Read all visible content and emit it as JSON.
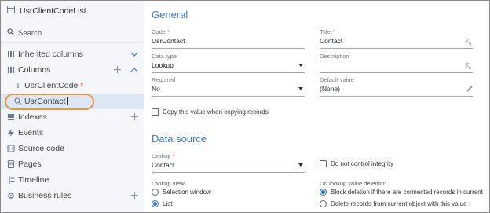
{
  "sidebar": {
    "title": "UsrClientCodeList",
    "search_label": "Search",
    "items": [
      {
        "label": "Inherited columns",
        "icon": "inherited-columns-icon"
      },
      {
        "label": "Columns",
        "icon": "columns-icon"
      },
      {
        "label": "UsrClientCode",
        "required_mark": "*",
        "icon": "text-type-icon"
      },
      {
        "label": "UsrContact",
        "icon": "lookup-search-icon"
      },
      {
        "label": "Indexes",
        "icon": "indexes-icon"
      },
      {
        "label": "Events",
        "icon": "events-icon"
      },
      {
        "label": "Source code",
        "icon": "source-code-icon"
      },
      {
        "label": "Pages",
        "icon": "pages-icon"
      },
      {
        "label": "Timeline",
        "icon": "timeline-icon"
      },
      {
        "label": "Business rules",
        "icon": "business-rules-icon"
      }
    ]
  },
  "general": {
    "heading": "General",
    "code": {
      "label": "Code",
      "required": "*",
      "value": "UsrContact"
    },
    "title": {
      "label": "Title",
      "required": "*",
      "value": "Contact"
    },
    "data_type": {
      "label": "Data type",
      "value": "Lookup"
    },
    "description": {
      "label": "Description",
      "value": ""
    },
    "required": {
      "label": "Required",
      "value": "No"
    },
    "default_value": {
      "label": "Default value",
      "value": "(None)"
    },
    "copy_checkbox": "Copy this value when copying records"
  },
  "data_source": {
    "heading": "Data source",
    "lookup": {
      "label": "Lookup",
      "required": "*",
      "value": "Contact"
    },
    "integrity_checkbox": "Do not control integrity",
    "lookup_view_label": "Lookup view",
    "lookup_view_options": [
      "Selection window",
      "List"
    ],
    "lookup_view_selected": "List",
    "deletion_label": "On lookup value deletion:",
    "deletion_options": [
      "Block deletion if there are connected records in current",
      "Delete records from current object with this value"
    ],
    "deletion_selected": 0
  },
  "colors": {
    "accent": "#3977c8",
    "highlight": "#e0964b",
    "selected_bg": "#dde6f3",
    "required": "#e23b3b"
  }
}
